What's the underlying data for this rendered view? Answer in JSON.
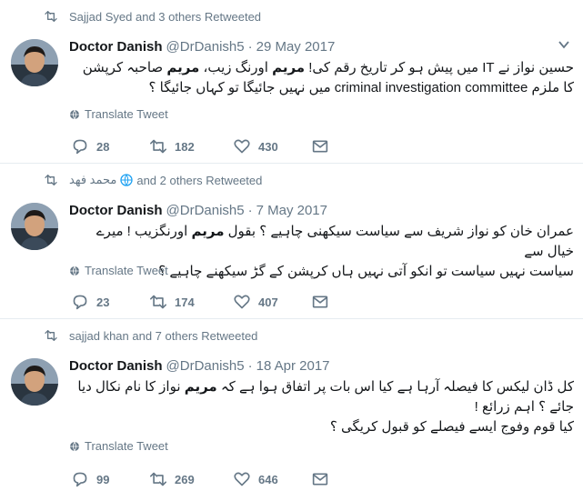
{
  "tweets": [
    {
      "context": {
        "text_before": "",
        "text": "Sajjad Syed and 3 others Retweeted"
      },
      "author": {
        "name": "Doctor Danish",
        "handle": "@DrDanish5",
        "separator": "·",
        "date": "29 May 2017"
      },
      "lines": [
        "حسین نواز نے IT میں پیش ہو کر تاریخ رقم کی! مریم اورنگ زیب، مریم صاحبہ کرپشن",
        "کا ملزم criminal investigation committee میں نہیں جائیگا تو کہاں جائیگا ؟"
      ],
      "translate": "Translate Tweet",
      "counts": {
        "reply": "28",
        "retweet": "182",
        "like": "430"
      }
    },
    {
      "context": {
        "text_before": "محمد فهد",
        "text": "and 2 others Retweeted"
      },
      "author": {
        "name": "Doctor Danish",
        "handle": "@DrDanish5",
        "separator": "·",
        "date": "7 May 2017"
      },
      "lines": [
        "عمران خان کو نواز شریف سے سیاست سیکھنی چاہیے ؟ بقول مریم اورنگزیب ! میرے خیال سے",
        "سیاست نہیں سیاست تو انکو آتی نہیں ہاں کرپشن کے گڑ سیکھنے چاہیے ؟"
      ],
      "translate": "Translate Tweet",
      "counts": {
        "reply": "23",
        "retweet": "174",
        "like": "407"
      }
    },
    {
      "context": {
        "text_before": "",
        "text": "sajjad khan and 7 others Retweeted"
      },
      "author": {
        "name": "Doctor Danish",
        "handle": "@DrDanish5",
        "separator": "·",
        "date": "18 Apr 2017"
      },
      "lines": [
        "کل ڈان لیکس کا فیصلہ آرہا ہے کیا اس بات پر اتفاق ہوا ہے کہ مریم نواز کا نام نکال دیا",
        "جائے ؟ اہم زرائع !",
        "کیا قوم وفوج ایسے فیصلے کو قبول کریگی ؟"
      ],
      "translate": "Translate Tweet",
      "counts": {
        "reply": "99",
        "retweet": "269",
        "like": "646"
      }
    }
  ],
  "colors": {
    "secondary": "#657786",
    "text": "#14171a",
    "divider": "#e6ecf0"
  },
  "icons": [
    "retweet-icon",
    "globe-icon",
    "chevron-down-icon",
    "translate-globe-icon",
    "reply-icon",
    "like-icon",
    "direct-message-icon"
  ]
}
